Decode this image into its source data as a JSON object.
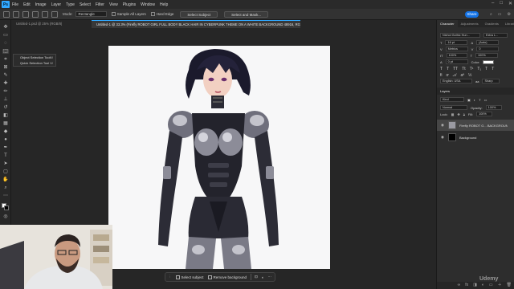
{
  "app": {
    "logo": "Ps",
    "menus": [
      "File",
      "Edit",
      "Image",
      "Layer",
      "Type",
      "Select",
      "Filter",
      "View",
      "Plugins",
      "Window",
      "Help"
    ]
  },
  "options": {
    "mode_label": "Mode:",
    "mode_value": "Rectangle",
    "sample_all_layers": "Sample All Layers",
    "hard_edge": "Hard Edge",
    "select_subject": "Select Subject",
    "select_and_mask": "Select and Mask...",
    "share": "Share"
  },
  "tabs": [
    {
      "label": "Untitled-1.psd @ 25% (RGB/8)",
      "active": false
    },
    {
      "label": "Untitled-1 @ 33.3% (Firefly ROBOT GIRL FULL BODY BLACK HAIR IN CYBERPUNK THEME ON A WHITE BACKGROUND 48916, RGB/8) *",
      "active": true
    }
  ],
  "flyout": {
    "items": [
      {
        "label": "Object Selection Tool",
        "key": "W"
      },
      {
        "label": "Quick Selection Tool",
        "key": "W"
      }
    ]
  },
  "context_bar": {
    "select_subject": "Select subject",
    "remove_background": "Remove background"
  },
  "panels": {
    "tabs": [
      "Character",
      "Adjustments",
      "Gradients",
      "Libraries"
    ],
    "char": {
      "font": "Nichol Gothic Hun...",
      "style": "Extra L...",
      "size": "16 pt",
      "leading": "(Auto)",
      "kerning": "Metrics",
      "tracking": "0",
      "vscale": "100%",
      "hscale": "100%",
      "baseline": "0 pt",
      "color_label": "Color:",
      "language": "English: USA",
      "aa": "Sharp"
    },
    "layers": {
      "title": "Layers",
      "kind": "Kind",
      "blend": "Normal",
      "opacity_label": "Opacity:",
      "opacity": "100%",
      "lock_label": "Lock:",
      "fill_label": "Fill:",
      "fill": "100%",
      "items": [
        {
          "name": "Firefly ROBOT G... BACKGROUND 48916",
          "selected": true
        },
        {
          "name": "Background",
          "selected": false
        }
      ]
    }
  },
  "watermark": "Udemy",
  "colors": {
    "accent": "#31a8ff",
    "share": "#1473e6",
    "canvas_bg": "#262626",
    "panel_bg": "#2d2d2d"
  }
}
